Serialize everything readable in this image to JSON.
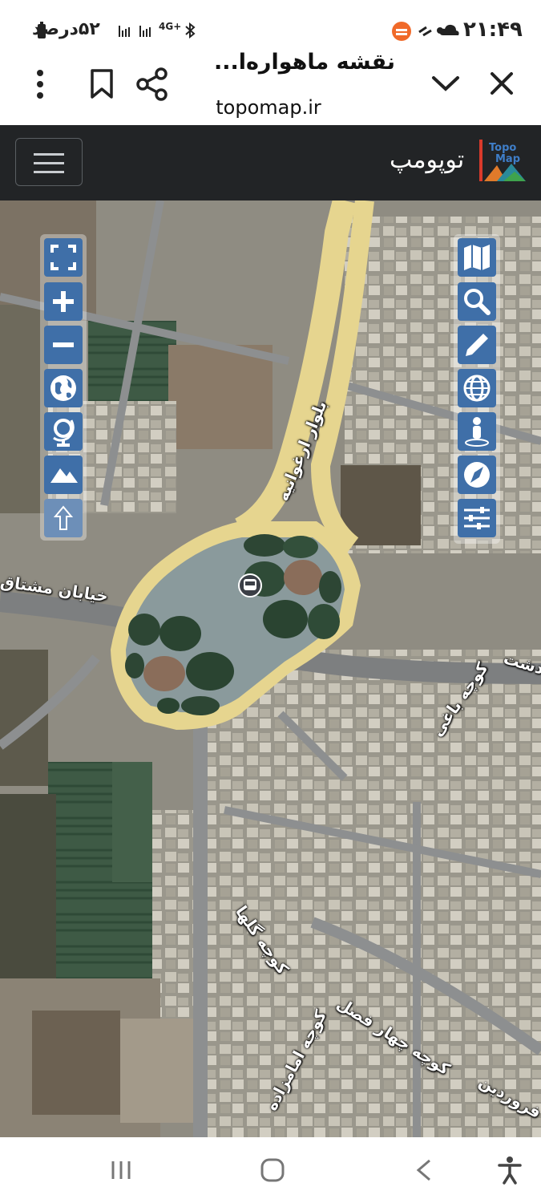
{
  "status_bar": {
    "time": "۲۱:۴۹",
    "battery": "۵۲درصد",
    "network": "4G+"
  },
  "browser": {
    "page_title": "نقشه ماهواره‌ا...",
    "url": "topomap.ir"
  },
  "site": {
    "brand_title": "توپومپ",
    "logo_text_top": "Topo",
    "logo_text_bottom": "Map"
  },
  "map": {
    "streets": [
      {
        "id": "blvd",
        "label": "بلوار ارغوانیه"
      },
      {
        "id": "mashtagh",
        "label": "خیابان مشتاق"
      },
      {
        "id": "dasht",
        "label": "دشت"
      },
      {
        "id": "bagh",
        "label": "کوچه باغی"
      },
      {
        "id": "golha",
        "label": "کوچه گلها"
      },
      {
        "id": "charfasl",
        "label": "کوچه چهار فصل"
      },
      {
        "id": "emamzadeh",
        "label": "کوچه امامزاده"
      },
      {
        "id": "farvardin",
        "label": "کوچه فروردین"
      }
    ],
    "left_controls": [
      "fullscreen-icon",
      "zoom-in-icon",
      "zoom-out-icon",
      "globe-icon",
      "globe-stand-icon",
      "mountain-icon",
      "up-arrow-icon"
    ],
    "right_controls": [
      "map-layers-icon",
      "search-icon",
      "pencil-icon",
      "web-globe-icon",
      "person-location-icon",
      "compass-icon",
      "sliders-icon"
    ]
  },
  "colors": {
    "navbar": "#222426",
    "control_blue": "#3f6fa8",
    "road_yellow": "#e6d58f"
  }
}
